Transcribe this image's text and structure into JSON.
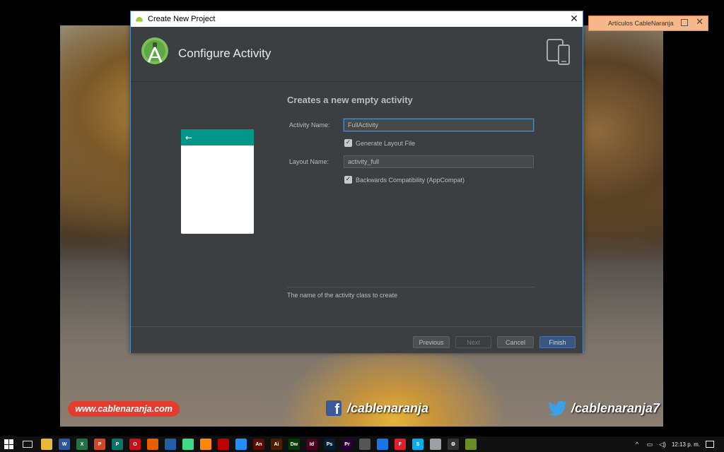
{
  "dialog": {
    "title": "Create New Project",
    "header_title": "Configure Activity",
    "form": {
      "heading": "Creates a new empty activity",
      "activity_name_label": "Activity Name:",
      "activity_name_value": "FullActivity",
      "generate_layout_label": "Generate Layout File",
      "generate_layout_checked": true,
      "layout_name_label": "Layout Name:",
      "layout_name_value": "activity_full",
      "backwards_compat_label": "Backwards Compatibility (AppCompat)",
      "backwards_compat_checked": true
    },
    "preview": {
      "accent_color": "#009688",
      "back_glyph": "←"
    },
    "hint": "The name of the activity class to create",
    "buttons": {
      "previous": "Previous",
      "next": "Next",
      "cancel": "Cancel",
      "finish": "Finish"
    }
  },
  "article_window": {
    "title": "Artículos CableNaranja"
  },
  "wallpaper": {
    "site": "www.cablenaranja.com",
    "facebook": "/cablenaranja",
    "twitter": "/cablenaranja7"
  },
  "taskbar": {
    "clock": "12:13 p. m.",
    "apps": [
      {
        "name": "file-explorer-icon",
        "color": "#e8b83a",
        "glyph": ""
      },
      {
        "name": "word-icon",
        "color": "#2b579a",
        "glyph": "W"
      },
      {
        "name": "excel-icon",
        "color": "#217346",
        "glyph": "X"
      },
      {
        "name": "powerpoint-icon",
        "color": "#d24726",
        "glyph": "P"
      },
      {
        "name": "publisher-icon",
        "color": "#077568",
        "glyph": "P"
      },
      {
        "name": "opera-icon",
        "color": "#cc0f16",
        "glyph": "O"
      },
      {
        "name": "firefox-icon",
        "color": "#e66000",
        "glyph": ""
      },
      {
        "name": "virtualbox-icon",
        "color": "#1f5fa8",
        "glyph": ""
      },
      {
        "name": "android-studio-icon",
        "color": "#3ddc84",
        "glyph": ""
      },
      {
        "name": "vlc-icon",
        "color": "#ff8800",
        "glyph": ""
      },
      {
        "name": "filezilla-icon",
        "color": "#bf0000",
        "glyph": ""
      },
      {
        "name": "cube-app-icon",
        "color": "#1e90ff",
        "glyph": ""
      },
      {
        "name": "animate-icon",
        "color": "#5a0e00",
        "glyph": "An"
      },
      {
        "name": "illustrator-icon",
        "color": "#4b1f00",
        "glyph": "Ai"
      },
      {
        "name": "dreamweaver-icon",
        "color": "#063b06",
        "glyph": "Dw"
      },
      {
        "name": "indesign-icon",
        "color": "#49021f",
        "glyph": "Id"
      },
      {
        "name": "photoshop-icon",
        "color": "#001d34",
        "glyph": "Ps"
      },
      {
        "name": "premiere-icon",
        "color": "#2a0034",
        "glyph": "Pr"
      },
      {
        "name": "media-player-icon",
        "color": "#555555",
        "glyph": ""
      },
      {
        "name": "download-app-icon",
        "color": "#1a73e8",
        "glyph": ""
      },
      {
        "name": "foxit-icon",
        "color": "#e41d2b",
        "glyph": "F"
      },
      {
        "name": "skype-icon",
        "color": "#00aff0",
        "glyph": "S"
      },
      {
        "name": "notes-icon",
        "color": "#9aa0a6",
        "glyph": ""
      },
      {
        "name": "settings-icon",
        "color": "#333333",
        "glyph": "⚙"
      },
      {
        "name": "paint-icon",
        "color": "#6b8e23",
        "glyph": ""
      }
    ]
  }
}
